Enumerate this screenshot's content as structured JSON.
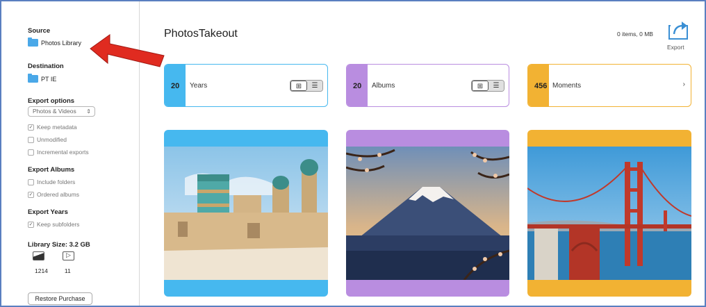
{
  "sidebar": {
    "source_heading": "Source",
    "source_value": "Photos Library",
    "destination_heading": "Destination",
    "destination_value": "PT IE",
    "export_options_heading": "Export options",
    "export_select_value": "Photos & Videos",
    "keep_metadata": "Keep metadata",
    "unmodified": "Unmodified",
    "incremental": "Incremental exports",
    "export_albums_heading": "Export Albums",
    "include_folders": "Include folders",
    "ordered_albums": "Ordered albums",
    "export_years_heading": "Export Years",
    "keep_subfolders": "Keep subfolders",
    "library_size": "Library Size: 3.2 GB",
    "photo_count": "1214",
    "video_count": "11",
    "restore_button": "Restore Purchase"
  },
  "header": {
    "title": "PhotosTakeout",
    "info": "0 items, 0 MB",
    "export_label": "Export"
  },
  "cards": [
    {
      "count": "20",
      "label": "Years",
      "color": "#46b8ef"
    },
    {
      "count": "20",
      "label": "Albums",
      "color": "#b98de0"
    },
    {
      "count": "456",
      "label": "Moments",
      "color": "#f2b233"
    }
  ],
  "colors": {
    "accent_blue": "#46b8ef",
    "accent_purple": "#b98de0",
    "accent_orange": "#f2b233",
    "annotation_arrow": "#e02b20"
  }
}
